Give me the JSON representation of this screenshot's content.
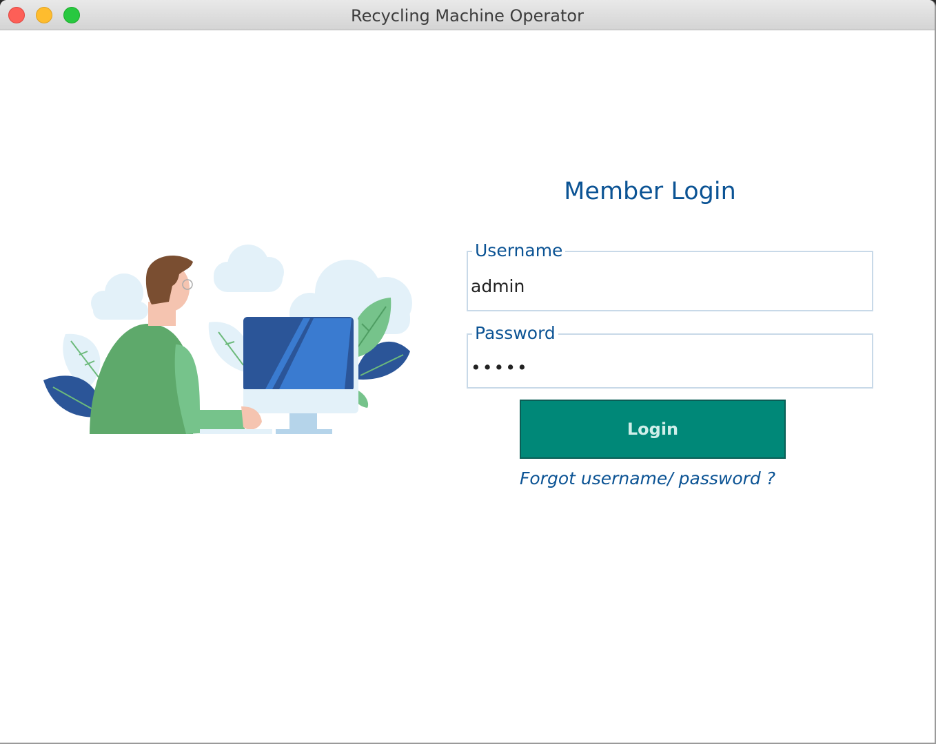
{
  "window": {
    "title": "Recycling Machine Operator"
  },
  "login": {
    "heading": "Member Login",
    "username_label": "Username",
    "username_value": "admin",
    "password_label": "Password",
    "password_value": "•••••",
    "login_button": "Login",
    "forgot_link": "Forgot username/ password ?"
  },
  "illustration": {
    "icon": "person-at-computer-illustration"
  },
  "colors": {
    "accent_text": "#0b5394",
    "button_bg": "#008878",
    "field_border": "#c8d9e8"
  }
}
